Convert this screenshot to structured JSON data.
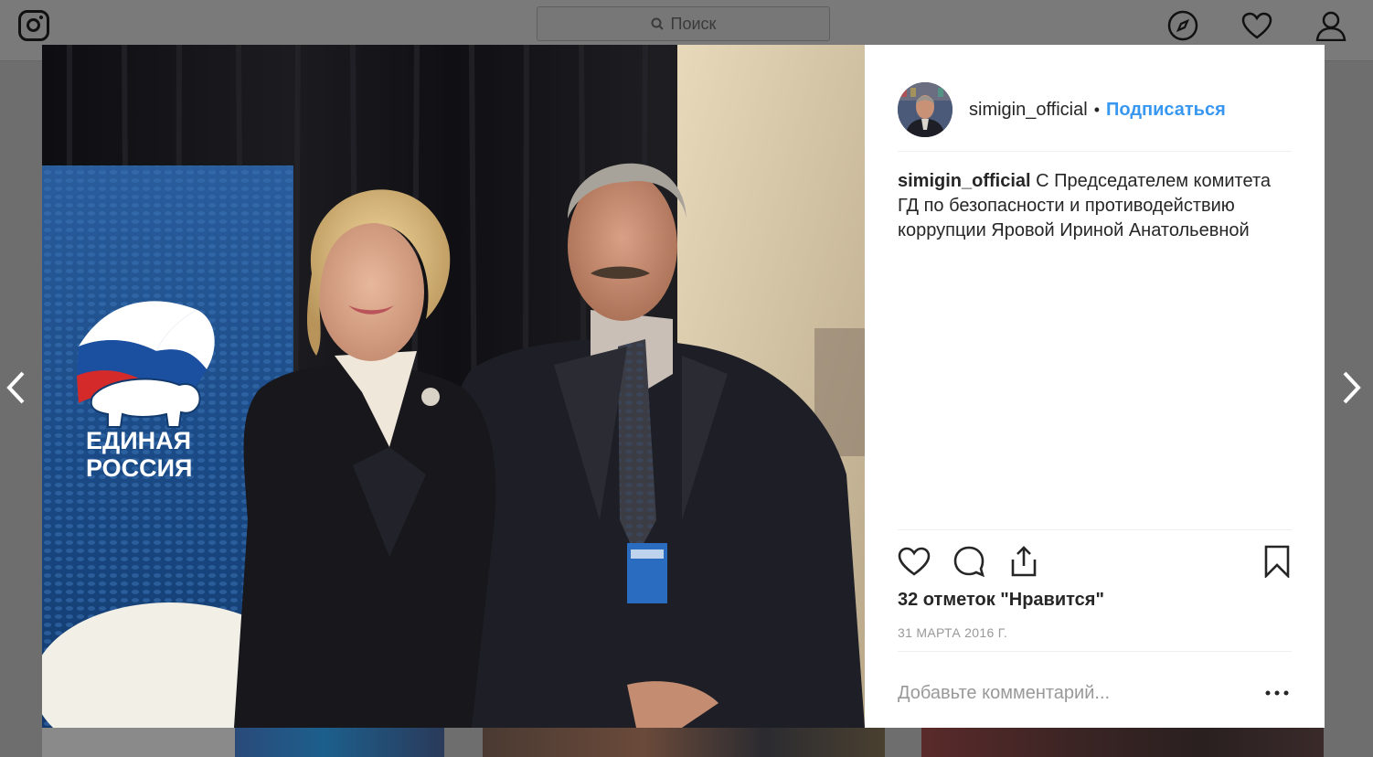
{
  "search": {
    "placeholder": "Поиск"
  },
  "post": {
    "username": "simigin_official",
    "separator": "•",
    "follow_label": "Подписаться",
    "caption_user": "simigin_official",
    "caption_text": "С Председателем комитета ГД по безопасности и противодействию коррупции Яровой Ириной Анатольевной",
    "likes": "32 отметок \"Нравится\"",
    "date": "31 МАРТА 2016 Г.",
    "comment_placeholder": "Добавьте комментарий...",
    "more_label": "•••"
  },
  "photo": {
    "banner_text_line1": "ЕДИНАЯ",
    "banner_text_line2": "РОССИЯ"
  },
  "colors": {
    "accent": "#3897f0",
    "text": "#262626",
    "muted": "#999999",
    "overlay": "#6e6e6e"
  }
}
